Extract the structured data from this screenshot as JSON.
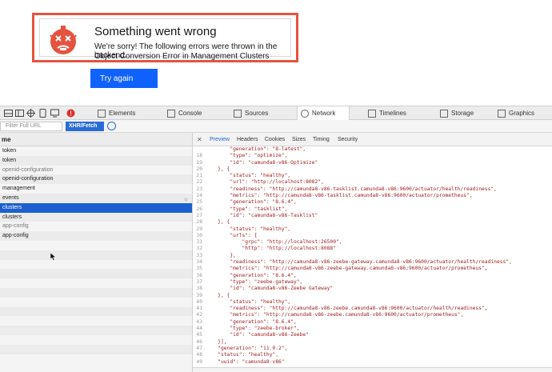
{
  "error": {
    "title": "Something went wrong",
    "line1": "We're sorry! The following errors were thrown in the backend.",
    "line2": "Object Conversion Error in Management Clusters",
    "button": "Try again"
  },
  "devtools": {
    "tabs": [
      {
        "label": "Elements",
        "icon": "elements-icon"
      },
      {
        "label": "Console",
        "icon": "console-icon"
      },
      {
        "label": "Sources",
        "icon": "sources-icon"
      },
      {
        "label": "Network",
        "icon": "network-icon",
        "active": true
      },
      {
        "label": "Timelines",
        "icon": "timelines-icon"
      },
      {
        "label": "Storage",
        "icon": "storage-icon"
      },
      {
        "label": "Graphics",
        "icon": "graphics-icon"
      }
    ],
    "filter": {
      "placeholder": "Filter Full URL",
      "type_button": "XHR/Fetch"
    },
    "list_header": "me",
    "requests": [
      {
        "name": "token",
        "style": "normal"
      },
      {
        "name": "token",
        "style": "normal"
      },
      {
        "name": "openid-configuration",
        "style": "grey"
      },
      {
        "name": "openid-configuration",
        "style": "normal"
      },
      {
        "name": "management",
        "style": "normal"
      },
      {
        "name": "events",
        "style": "normal",
        "spinner": true
      },
      {
        "name": "clusters",
        "style": "selected"
      },
      {
        "name": "clusters",
        "style": "normal"
      },
      {
        "name": "app-config",
        "style": "grey"
      },
      {
        "name": "app-config",
        "style": "normal"
      }
    ],
    "detail_tabs": [
      "Preview",
      "Headers",
      "Cookies",
      "Sizes",
      "Timing",
      "Security"
    ],
    "active_detail_tab": "Preview",
    "code_lines": [
      {
        "n": "",
        "t": "        \"generation\": \"8-latest\","
      },
      {
        "n": "18",
        "t": "        \"type\": \"optimize\","
      },
      {
        "n": "19",
        "t": "        \"id\": \"camunda8-v86-Optimize\""
      },
      {
        "n": "20",
        "t": "    }, {"
      },
      {
        "n": "21",
        "t": "        \"status\": \"healthy\","
      },
      {
        "n": "22",
        "t": "        \"url\": \"http://localhost:8082\","
      },
      {
        "n": "23",
        "t": "        \"readiness\": \"http://camunda8-v86-tasklist.camunda8-v86:9600/actuator/health/readiness\","
      },
      {
        "n": "24",
        "t": "        \"metrics\": \"http://camunda8-v86-tasklist.camunda8-v86:9600/actuator/prometheus\","
      },
      {
        "n": "25",
        "t": "        \"generation\": \"8.6.4\","
      },
      {
        "n": "26",
        "t": "        \"type\": \"tasklist\","
      },
      {
        "n": "27",
        "t": "        \"id\": \"camunda8-v86-Tasklist\""
      },
      {
        "n": "28",
        "t": "    }, {"
      },
      {
        "n": "29",
        "t": "        \"status\": \"healthy\","
      },
      {
        "n": "30",
        "t": "        \"urls\": {"
      },
      {
        "n": "31",
        "t": "            \"grpc\": \"http://localhost:26500\","
      },
      {
        "n": "32",
        "t": "            \"http\": \"http://localhost:8088\""
      },
      {
        "n": "33",
        "t": "        },"
      },
      {
        "n": "34",
        "t": "        \"readiness\": \"http://camunda8-v86-zeebe-gateway.camunda8-v86:9600/actuator/health/readiness\","
      },
      {
        "n": "35",
        "t": "        \"metrics\": \"http://camunda8-v86-zeebe-gateway.camunda8-v86:9600/actuator/prometheus\","
      },
      {
        "n": "36",
        "t": "        \"generation\": \"8.6.4\","
      },
      {
        "n": "37",
        "t": "        \"type\": \"zeebe-gateway\","
      },
      {
        "n": "38",
        "t": "        \"id\": \"camunda8-v86-Zeebe Gateway\""
      },
      {
        "n": "39",
        "t": "    }, {"
      },
      {
        "n": "40",
        "t": "        \"status\": \"healthy\","
      },
      {
        "n": "41",
        "t": "        \"readiness\": \"http://camunda8-v86-zeebe.camunda8-v86:9600/actuator/health/readiness\","
      },
      {
        "n": "42",
        "t": "        \"metrics\": \"http://camunda8-v86-zeebe.camunda8-v86:9600/actuator/prometheus\","
      },
      {
        "n": "43",
        "t": "        \"generation\": \"8.6.4\","
      },
      {
        "n": "44",
        "t": "        \"type\": \"zeebe-broker\","
      },
      {
        "n": "45",
        "t": "        \"id\": \"camunda8-v86-Zeebe\""
      },
      {
        "n": "46",
        "t": "    }],"
      },
      {
        "n": "47",
        "t": "    \"generation\": \"11.0.2\","
      },
      {
        "n": "48",
        "t": "    \"status\": \"healthy\","
      },
      {
        "n": "49",
        "t": "    \"uuid\": \"camunda8-v86\""
      },
      {
        "n": "50",
        "t": "}"
      },
      {
        "n": "51",
        "t": ""
      }
    ]
  },
  "colors": {
    "error_border": "#e5533f",
    "primary_button": "#0f62fe",
    "selected_row": "#1c5fcf",
    "active_tab_text": "#1a64d6",
    "json_string": "#9a1b1b"
  }
}
